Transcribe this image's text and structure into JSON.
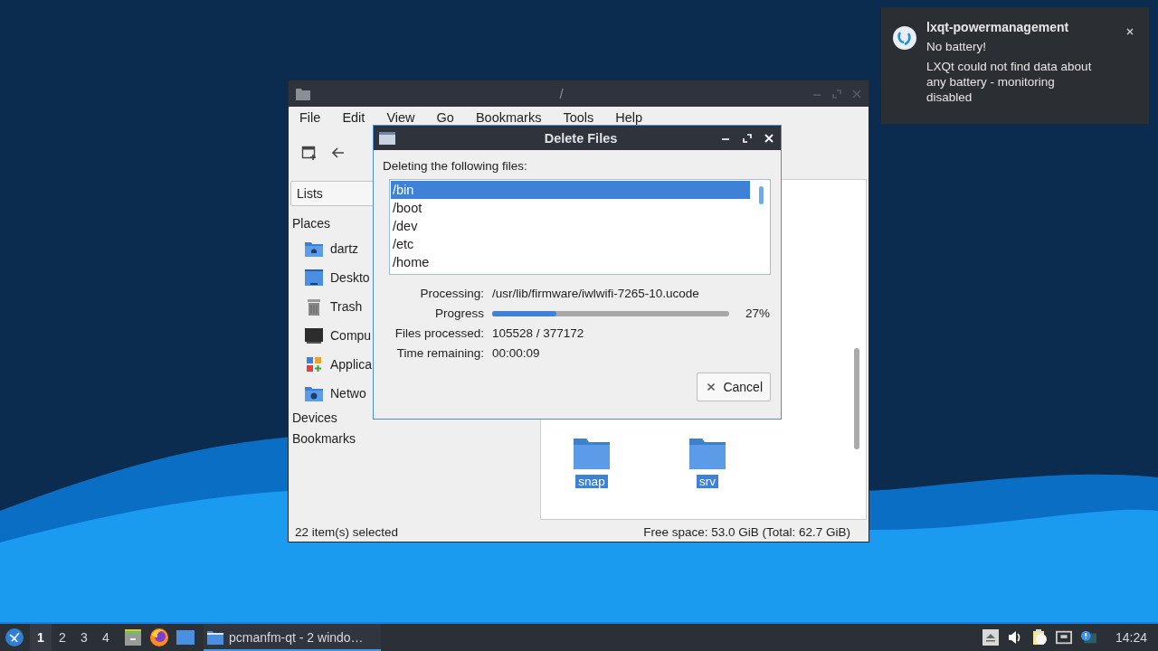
{
  "notification": {
    "app": "lxqt-powermanagement",
    "summary": "No battery!",
    "body": "LXQt could not find data about any battery - monitoring disabled"
  },
  "file_manager": {
    "title": "/",
    "menu": [
      "File",
      "Edit",
      "View",
      "Go",
      "Bookmarks",
      "Tools",
      "Help"
    ],
    "pane_selector": "Lists",
    "sections": [
      {
        "label": "Places",
        "items": [
          {
            "kind": "home",
            "label": "dartz"
          },
          {
            "kind": "desktop",
            "label": "Deskto"
          },
          {
            "kind": "trash",
            "label": "Trash"
          },
          {
            "kind": "computer",
            "label": "Compu"
          },
          {
            "kind": "applications",
            "label": "Applica"
          },
          {
            "kind": "network",
            "label": "Netwo"
          }
        ]
      },
      {
        "label": "Devices"
      },
      {
        "label": "Bookmarks"
      }
    ],
    "files": [
      {
        "name": "snap",
        "selected": true
      },
      {
        "name": "srv",
        "selected": true
      }
    ],
    "status": {
      "selection": "22 item(s) selected",
      "free_space": "Free space: 53.0 GiB (Total: 62.7 GiB)"
    }
  },
  "dialog": {
    "title": "Delete Files",
    "heading": "Deleting the following files:",
    "files": [
      {
        "name": "/bin",
        "selected": true
      },
      {
        "name": "/boot",
        "selected": false
      },
      {
        "name": "/dev",
        "selected": false
      },
      {
        "name": "/etc",
        "selected": false
      },
      {
        "name": "/home",
        "selected": false
      }
    ],
    "fields": [
      {
        "kind": "text",
        "label": "Processing:",
        "value": "/usr/lib/firmware/iwlwifi-7265-10.ucode"
      },
      {
        "kind": "progress",
        "label": "Progress",
        "level": 0.27,
        "value": "27%"
      },
      {
        "kind": "text",
        "label": "Files processed:",
        "value": "105528 / 377172"
      },
      {
        "kind": "text",
        "label": "Time remaining:",
        "value": "00:00:09"
      }
    ],
    "cancel": "Cancel"
  },
  "taskbar": {
    "desktops": [
      {
        "label": "1",
        "selected": true
      },
      {
        "label": "2",
        "selected": false
      },
      {
        "label": "3",
        "selected": false
      },
      {
        "label": "4",
        "selected": false
      }
    ],
    "task": {
      "label": "pcmanfm-qt - 2 windo…",
      "active": true
    },
    "clock": "14:24"
  }
}
